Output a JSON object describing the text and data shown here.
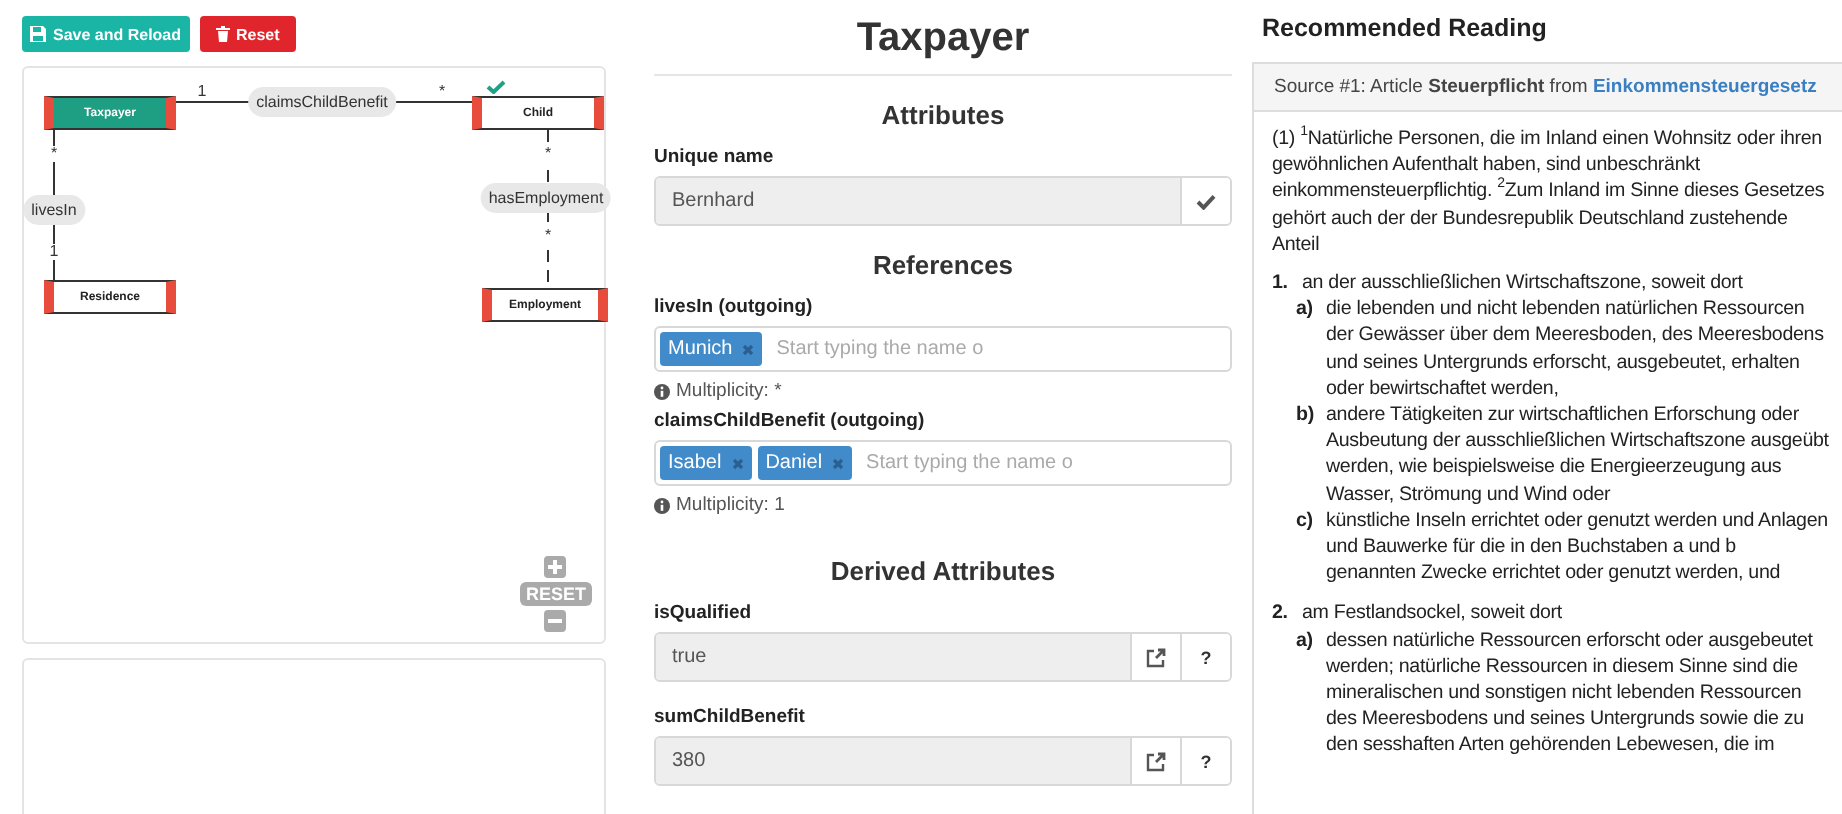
{
  "toolbar": [
    {
      "label": "Save and Reload",
      "kind": "save"
    },
    {
      "label": "Reset",
      "kind": "reset"
    }
  ],
  "diagram": {
    "nodes": [
      {
        "label": "Taxpayer",
        "selected": true,
        "valid": false
      },
      {
        "label": "Child",
        "selected": false,
        "valid": true
      },
      {
        "label": "Residence",
        "selected": false,
        "valid": false
      },
      {
        "label": "Employment",
        "selected": false,
        "valid": false
      }
    ],
    "edges": [
      {
        "label": "claimsChildBenefit",
        "source_multiplicity": "1",
        "target_multiplicity": "*"
      },
      {
        "label": "livesIn",
        "source_multiplicity": "*",
        "target_multiplicity": "1"
      },
      {
        "label": "hasEmployment",
        "source_multiplicity": "*",
        "target_multiplicity": "*"
      }
    ],
    "zoom_reset": "RESET"
  },
  "form": {
    "title": "Taxpayer",
    "attributes": {
      "heading": "Attributes",
      "fields": [
        {
          "label": "Unique name",
          "value": "Bernhard"
        }
      ]
    },
    "references": {
      "heading": "References",
      "items": [
        {
          "label": "livesIn (outgoing)",
          "tags": [
            "Munich"
          ],
          "placeholder": "Start typing the name o",
          "multiplicity": "Multiplicity: *"
        },
        {
          "label": "claimsChildBenefit (outgoing)",
          "tags": [
            "Isabel",
            "Daniel"
          ],
          "placeholder": "Start typing the name o",
          "multiplicity": "Multiplicity: 1"
        }
      ]
    },
    "derived": {
      "heading": "Derived Attributes",
      "fields": [
        {
          "label": "isQualified",
          "value": "true",
          "help": "?"
        },
        {
          "label": "sumChildBenefit",
          "value": "380",
          "help": "?"
        }
      ]
    }
  },
  "reading": {
    "title": "Recommended Reading",
    "source": "Source #1: Article **Steuerpflicht** from",
    "source_link": "Einkommensteuergesetz",
    "intro": "(1) $^{1}$Natürliche Personen, die im Inland einen Wohnsitz oder ihren gewöhnlichen Aufenthalt haben, sind unbeschränkt einkommensteuerpflichtig. $^{2}$Zum Inland im Sinne dieses Gesetzes gehört auch der der Bundesrepublik Deutschland zustehende Anteil",
    "items": [
      {
        "number": "1.",
        "text": "an der ausschließlichen Wirtschaftszone, soweit dort",
        "subitems": [
          {
            "letter": "a)",
            "text": "die lebenden und nicht lebenden natürlichen Ressourcen der Gewässer über dem Meeresboden, des Meeresbodens und seines Untergrunds erforscht, ausgebeutet, erhalten oder bewirtschaftet werden,"
          },
          {
            "letter": "b)",
            "text": "andere Tätigkeiten zur wirtschaftlichen Erforschung oder Ausbeutung der ausschließlichen Wirtschaftszone ausgeübt werden, wie beispielsweise die Energieerzeugung aus Wasser, Strömung und Wind oder"
          },
          {
            "letter": "c)",
            "text": "künstliche Inseln errichtet oder genutzt werden und Anlagen und Bauwerke für die in den Buchstaben a und b genannten Zwecke errichtet oder genutzt werden, und"
          }
        ]
      },
      {
        "number": "2.",
        "text": "am Festlandsockel, soweit dort",
        "subitems": [
          {
            "letter": "a)",
            "text": "dessen natürliche Ressourcen erforscht oder ausgebeutet werden; natürliche Ressourcen in diesem Sinne sind die mineralischen und sonstigen nicht lebenden Ressourcen des Meeresbodens und seines Untergrunds sowie die zu den sesshaften Arten gehörenden Lebewesen, die im"
          }
        ]
      }
    ]
  }
}
